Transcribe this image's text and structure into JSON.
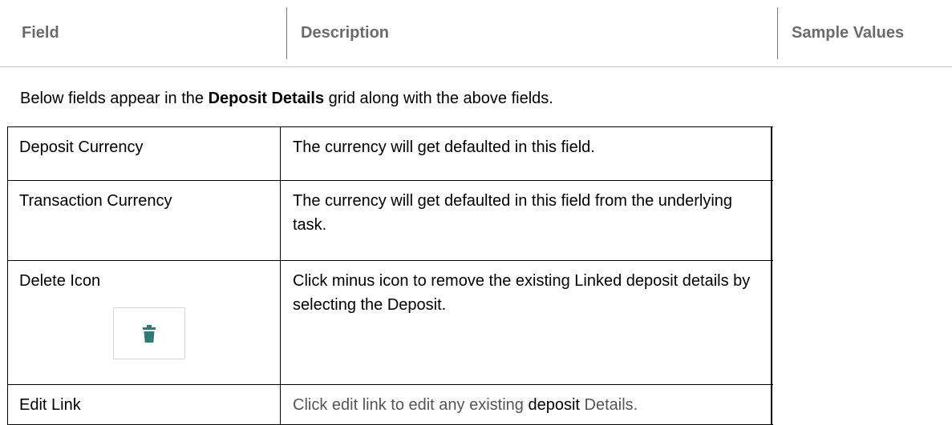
{
  "header": {
    "field": "Field",
    "description": "Description",
    "sample_values": "Sample Values"
  },
  "intro": {
    "prefix": "Below fields appear in the ",
    "bold": "Deposit Details",
    "suffix": " grid along with the above fields."
  },
  "rows": [
    {
      "field": "Deposit Currency",
      "description": "The currency will get defaulted in this field.",
      "sample": ""
    },
    {
      "field": "Transaction Currency",
      "description": "The currency will get defaulted in this field from the underlying task.",
      "sample": ""
    },
    {
      "field": "Delete Icon",
      "description": "Click minus icon to remove the existing Linked deposit details by selecting the Deposit.",
      "sample": "",
      "icon": "trash-icon",
      "icon_color": "#2e7b74"
    },
    {
      "field": "Edit Link",
      "description_part1": "Click edit link to edit any existing ",
      "description_part2": "deposit",
      "description_part3": " Details.",
      "sample": ""
    }
  ],
  "colors": {
    "header_text": "#6b6b6b",
    "border": "#000000",
    "icon": "#2e7b74"
  }
}
